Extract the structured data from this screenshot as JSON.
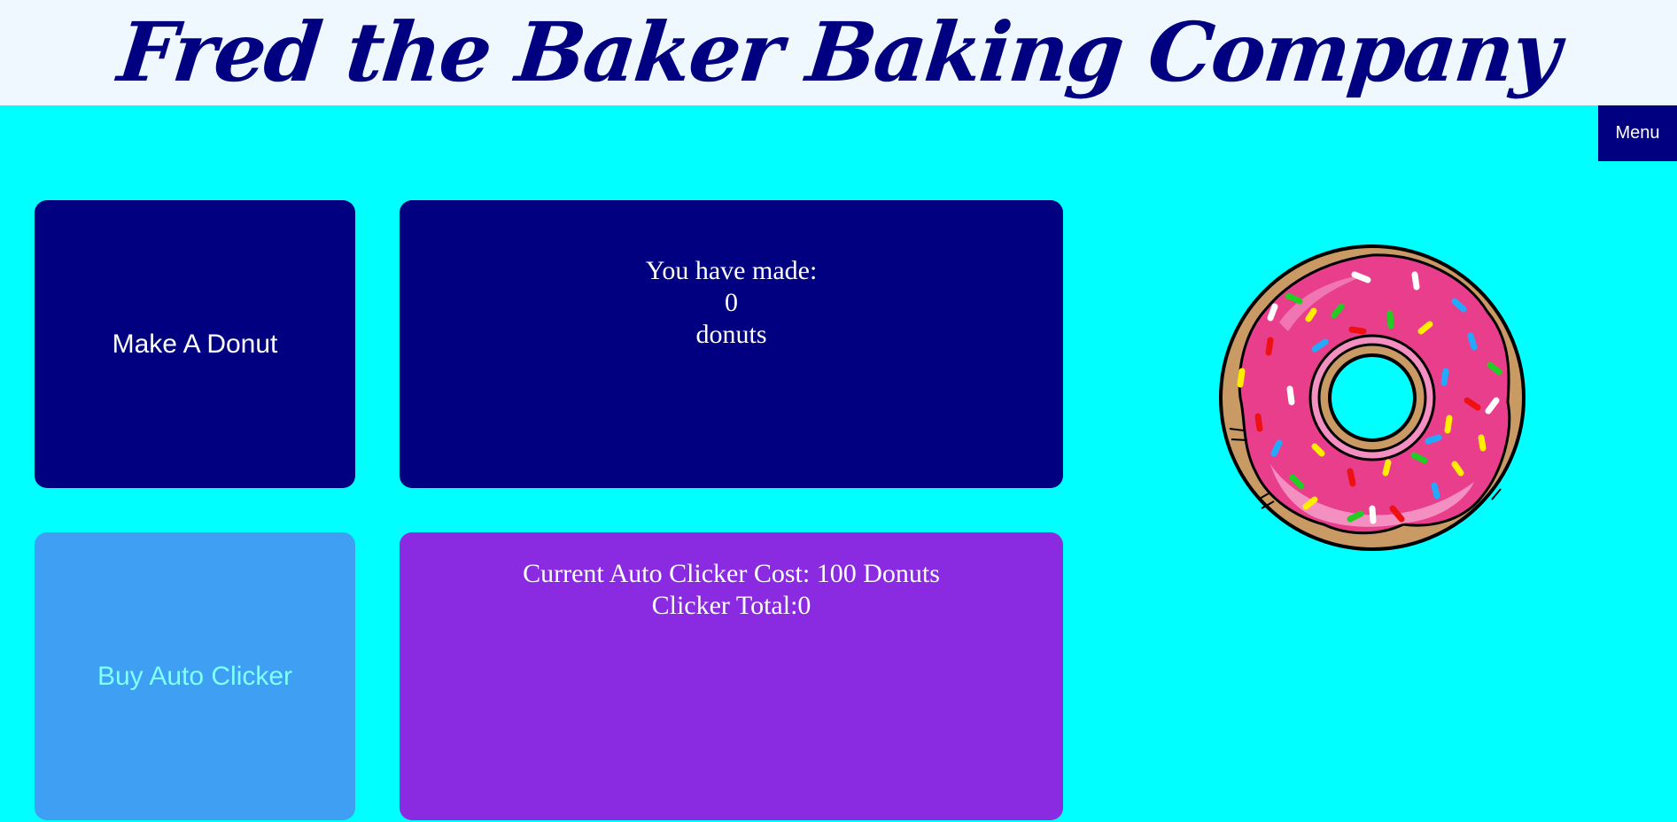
{
  "header": {
    "title": "Fred the Baker Baking Company"
  },
  "menu": {
    "label": "Menu"
  },
  "actions": {
    "make_donut_label": "Make A Donut",
    "buy_auto_clicker_label": "Buy Auto Clicker"
  },
  "counter": {
    "prefix": "You have made:",
    "count": "0",
    "suffix": "donuts"
  },
  "auto_clicker": {
    "cost_text": "Current Auto Clicker Cost: 100 Donuts",
    "total_label": "Clicker Total:",
    "total_value": "0"
  },
  "image": {
    "icon": "donut-image"
  },
  "colors": {
    "background": "#00ffff",
    "header_bg": "#f0f8ff",
    "navy": "#000080",
    "button_blue": "#3f9ff2",
    "purple": "#8a2be2"
  }
}
